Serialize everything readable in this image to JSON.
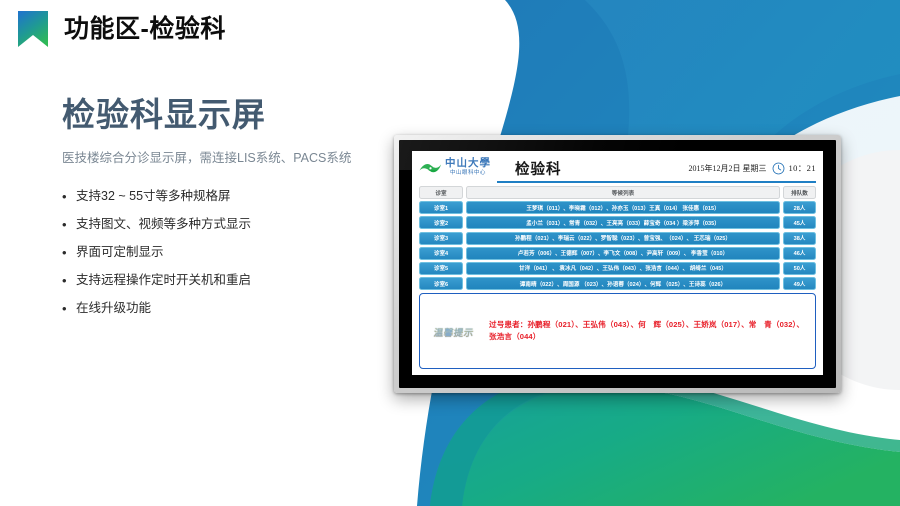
{
  "header": {
    "title": "功能区-检验科",
    "bookmark_icon": "bookmark-icon"
  },
  "left": {
    "title": "检验科显示屏",
    "subtitle": "医技楼综合分诊显示屏，需连接LIS系统、PACS系统",
    "bullets": [
      "支持32 ~ 55寸等多种规格屏",
      "支持图文、视频等多种方式显示",
      "界面可定制显示",
      "支持远程操作定时开关机和重启",
      "在线升级功能"
    ],
    "bullet_marker": "•"
  },
  "display": {
    "logo": {
      "name_cn": "中山大學",
      "name_sub": "中山眼科中心",
      "icon": "eye-logo-icon"
    },
    "title": "检验科",
    "date": "2015年12月2日 星期三",
    "clock_icon": "clock-icon",
    "time": "10：21",
    "table": {
      "columns": [
        "诊室",
        "等候列表",
        "排队数"
      ],
      "rows": [
        {
          "room": "诊室1",
          "list": "王梦琪（011）、李晓霜（012）、孙亦玉（013）王真（014）  张佳惠（015）",
          "count": "28人"
        },
        {
          "room": "诊室2",
          "list": "孟小兰（031）、常青（032）、王亮亮（033）薛宝奇（034 ）梁涉萍（035）",
          "count": "45人"
        },
        {
          "room": "诊室3",
          "list": "孙鹏程（021）、李瑞云（022）、罗智聪（023）、曾宝强、（024）、 王芯瑞（025）",
          "count": "38人"
        },
        {
          "room": "诊室4",
          "list": "卢若芳（006）、王德辉（007）、李飞文（008）、尹高轩（009）、 李香莹（010）",
          "count": "46人"
        },
        {
          "room": "诊室5",
          "list": "甘洋（041）     、 袁冰凡（042）、王弘伟（043）、张浩言（044）、 胡绮兰（045）",
          "count": "50人"
        },
        {
          "room": "诊室6",
          "list": "谭南晴（022）、周国源 （023）、孙语蓉（024）、何辉 （025）、王诗蕊（026）",
          "count": "49人"
        }
      ]
    },
    "notice": {
      "badge": "温馨提示",
      "text": "过号患者：孙鹏程（021）、王弘伟（043）、何　辉（025）、王娇岚（017）、常　青（032）、张浩言（044）"
    }
  },
  "colors": {
    "blue_accent": "#1f7fc4",
    "brand_blue": "#2185bd",
    "green_accent": "#19a97f",
    "title_slate": "#435a70",
    "notice_red": "#e8202a",
    "logo_green": "#19a843",
    "logo_blue": "#2f6fb5"
  }
}
